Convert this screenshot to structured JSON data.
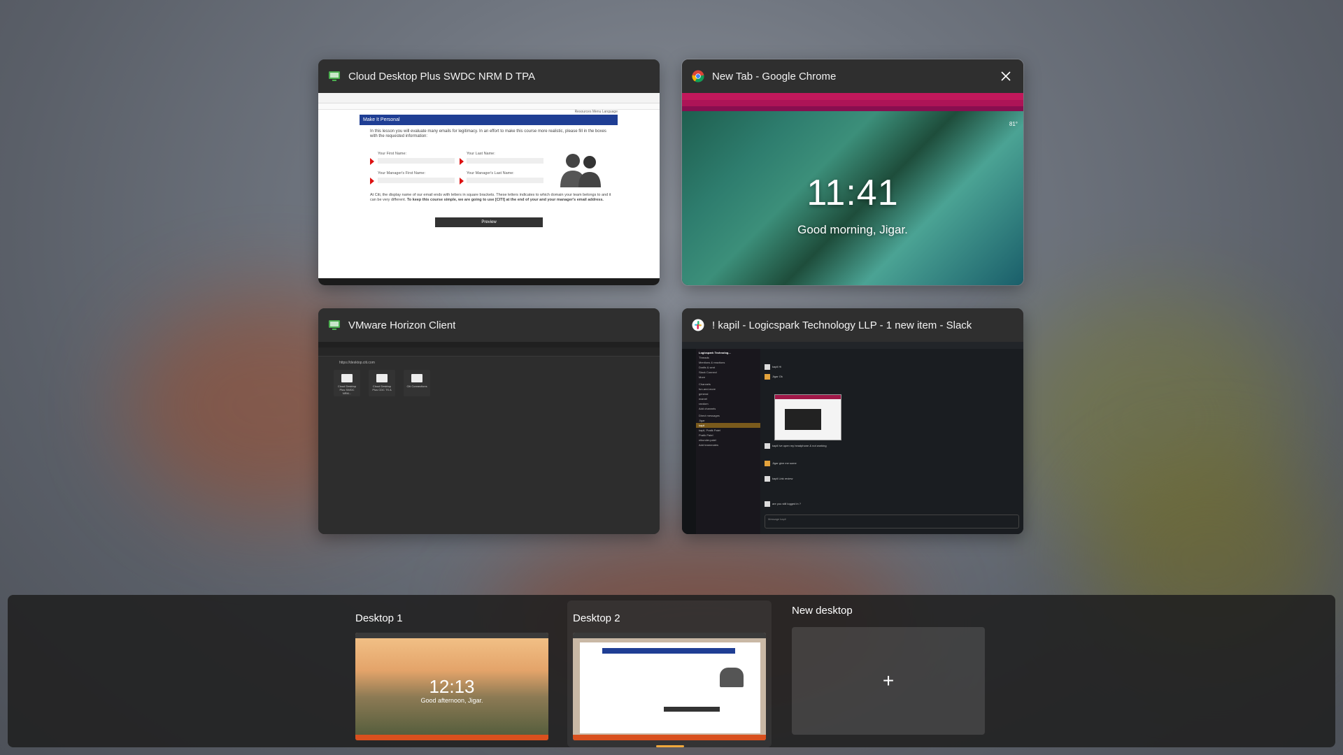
{
  "windows": [
    {
      "title": "Cloud Desktop Plus SWDC NRM D TPA",
      "icon": "monitor-icon",
      "content": {
        "banner": "Make It Personal",
        "intro": "In this lesson you will evaluate many emails for legitimacy. In an effort to make this course more realistic, please fill in the boxes with the requested information:",
        "fields": {
          "first_name": "Your First Name:",
          "last_name": "Your Last Name:",
          "mgr_first": "Your Manager's First Name:",
          "mgr_last": "Your Manager's Last Name:"
        },
        "note": "At Citi, the display name of our email ends with letters in square brackets. These letters indicates to which domain your team belongs to and it can be very different.",
        "note_bold": "To keep this course simple, we are going to use [CITI] at the end of your and your manager's email address.",
        "preview_label": "Preview",
        "topnav": "Resources  Menu  Language"
      }
    },
    {
      "title": "New Tab - Google Chrome",
      "icon": "chrome-icon",
      "content": {
        "clock": "11:41",
        "greeting": "Good morning, Jigar.",
        "temperature": "81°"
      }
    },
    {
      "title": "VMware Horizon Client",
      "icon": "monitor-icon",
      "content": {
        "server": "https://desktop.citi.com",
        "tiles": [
          "Cloud Desktop Plus SWDC NRM...",
          "Cloud Desktop Plus CDC TS A",
          "Citi Connections"
        ]
      }
    },
    {
      "title": "! kapil - Logicspark Technology LLP - 1 new item - Slack",
      "icon": "slack-icon",
      "content": {
        "workspace": "Logicspark Technolog...",
        "sidebar": [
          "Threads",
          "Mentions & reactions",
          "Drafts & sent",
          "Slack Connect",
          "More",
          "Channels",
          "fun-and-more",
          "general",
          "marvel",
          "random",
          "Add channels",
          "Direct messages",
          "Jigar",
          "kapil",
          "kapil, Pratik Patel",
          "Pratik Patel",
          "nikunder.patel",
          "Add teammates"
        ],
        "selected": "kapil",
        "messages": [
          "kapil  Hi",
          "Jigar  Ok",
          "kapil  Ive open my headphone & not working",
          "Jigar  give me some",
          "kapil  Link review",
          "are you still logged in ?"
        ],
        "input_placeholder": "Message kapil"
      }
    }
  ],
  "desktops": [
    {
      "label": "Desktop 1",
      "clock": "12:13",
      "greeting": "Good afternoon, Jigar."
    },
    {
      "label": "Desktop 2"
    }
  ],
  "new_desktop": {
    "label": "New desktop",
    "icon": "plus-icon",
    "symbol": "+"
  }
}
